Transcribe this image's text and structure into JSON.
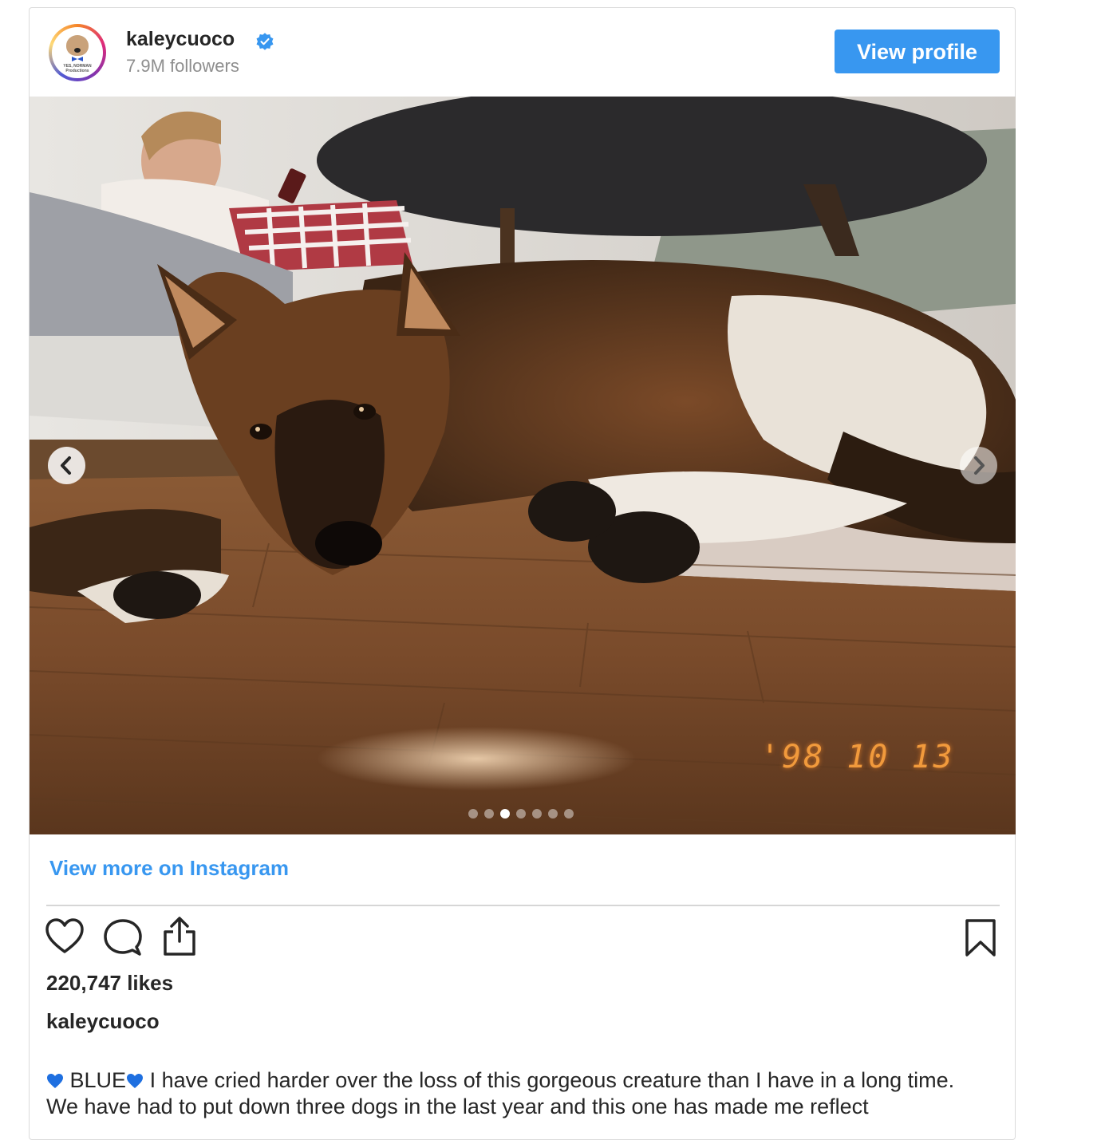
{
  "header": {
    "username": "kaleycuoco",
    "followers": "7.9M followers",
    "view_profile_label": "View profile",
    "avatar_logo_text": "YES, NORMAN Productions"
  },
  "photo": {
    "datestamp": "'98 10 13",
    "carousel": {
      "total": 7,
      "active_index": 2
    }
  },
  "links": {
    "view_more": "View more on Instagram"
  },
  "actions": {
    "icons": [
      "heart-icon",
      "comment-icon",
      "share-icon",
      "bookmark-icon"
    ]
  },
  "stats": {
    "likes": "220,747 likes"
  },
  "caption": {
    "username": "kaleycuoco",
    "emoji_title": "BLUE",
    "line1": "I have cried harder over the loss of this gorgeous creature than I have in a long",
    "line2": "time. We have had to put down three dogs in the last year and this one has made me reflect"
  },
  "colors": {
    "accent": "#3897f0",
    "text": "#262626",
    "muted": "#8e8e8e",
    "datestamp": "#f19a3c",
    "blue_heart": "#1e6fe0"
  }
}
